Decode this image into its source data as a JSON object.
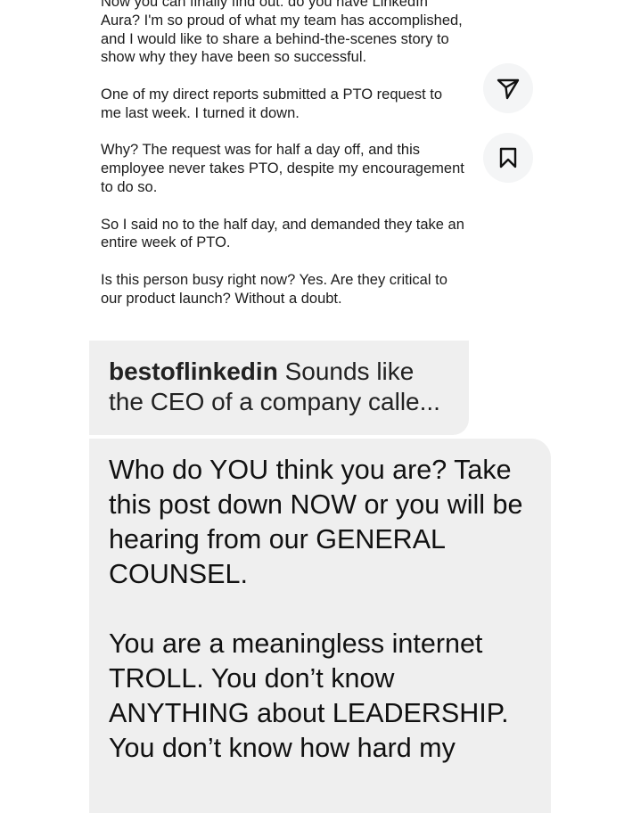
{
  "post": {
    "paragraphs": [
      "Now you can finally find out: do you have LinkedIn Aura? I'm so proud of what my team has accomplished, and I would like to share a behind-the-scenes story to show why they have been so successful.",
      "One of my direct reports submitted a PTO request to me last week. I turned it down.",
      "Why? The request was for half a day off, and this employee never takes PTO, despite my encouragement to do so.",
      "So I said no to the half day, and demanded they take an entire week of PTO.",
      "Is this person busy right now? Yes. Are they critical to our product launch? Without a doubt."
    ]
  },
  "actions": {
    "share_icon": "send-icon",
    "save_icon": "bookmark-icon"
  },
  "reply": {
    "username": "bestoflinkedin",
    "text": " Sounds like the CEO of a company calle..."
  },
  "message": {
    "paragraphs": [
      "Who do YOU think you are? Take this post down NOW or you will be hearing from our GENERAL COUNSEL.",
      "You are a meaningless internet TROLL. You don’t know ANYTHING about LEADERSHIP. You don’t know how hard my"
    ]
  },
  "colors": {
    "bubble": "#efefef",
    "action_button": "#f4f5f6",
    "icon": "#111111"
  }
}
